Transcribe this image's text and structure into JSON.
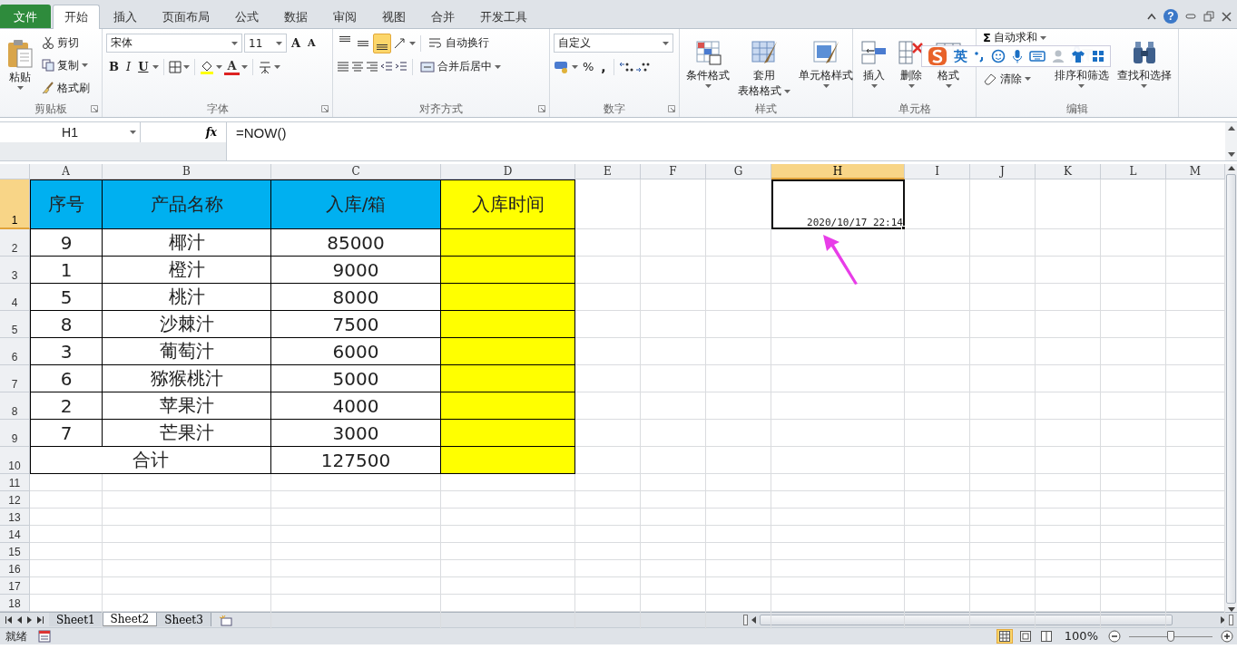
{
  "ribbon_tabs": [
    {
      "label": "文件",
      "kind": "file",
      "selected": false
    },
    {
      "label": "开始",
      "kind": "tab",
      "selected": true
    },
    {
      "label": "插入",
      "kind": "tab",
      "selected": false
    },
    {
      "label": "页面布局",
      "kind": "tab",
      "selected": false
    },
    {
      "label": "公式",
      "kind": "tab",
      "selected": false
    },
    {
      "label": "数据",
      "kind": "tab",
      "selected": false
    },
    {
      "label": "审阅",
      "kind": "tab",
      "selected": false
    },
    {
      "label": "视图",
      "kind": "tab",
      "selected": false
    },
    {
      "label": "合并",
      "kind": "tab",
      "selected": false
    },
    {
      "label": "开发工具",
      "kind": "tab",
      "selected": false
    }
  ],
  "window_controls": {
    "help": "?"
  },
  "clipboard": {
    "label": "剪贴板",
    "paste": "粘贴",
    "cut": "剪切",
    "copy": "复制",
    "format_painter": "格式刷"
  },
  "font": {
    "label": "字体",
    "font_name": "宋体",
    "font_size": "11",
    "grow": "A",
    "shrink": "A",
    "bold": "B",
    "italic": "I",
    "underline": "U",
    "font_color": "A"
  },
  "alignment": {
    "label": "对齐方式",
    "vertical_align": [
      {
        "selected": false
      },
      {
        "selected": false
      },
      {
        "selected": true
      }
    ],
    "wrap_text": "自动换行",
    "merge_center": "合并后居中"
  },
  "number": {
    "label": "数字",
    "format": "自定义",
    "percent": "%",
    "comma": ","
  },
  "styles": {
    "label": "样式",
    "buttons": [
      {
        "lines": [
          "条件格式"
        ],
        "kind": "conditional"
      },
      {
        "lines": [
          "套用",
          "表格格式"
        ],
        "kind": "table"
      },
      {
        "lines": [
          "单元格样式"
        ],
        "kind": "cellstyle"
      }
    ]
  },
  "cells": {
    "label": "单元格",
    "buttons": [
      {
        "lines": [
          "插入"
        ],
        "kind": "insert"
      },
      {
        "lines": [
          "删除"
        ],
        "kind": "delete"
      },
      {
        "lines": [
          "格式"
        ],
        "kind": "format"
      }
    ]
  },
  "editing": {
    "label": "编辑",
    "sum_symbol": "Σ",
    "autosum": "自动求和",
    "clear": "清除",
    "buttons": [
      {
        "lines": [
          "排序和筛选"
        ],
        "kind": "sort"
      },
      {
        "lines": [
          "查找和选择"
        ],
        "kind": "find"
      }
    ]
  },
  "ime_toolbar": {
    "lang": "英"
  },
  "formula_bar": {
    "name_box": "H1",
    "function_button": "fx",
    "formula": "=NOW()"
  },
  "sheet": {
    "columns": [
      {
        "label": "A",
        "selected": false
      },
      {
        "label": "B",
        "selected": false
      },
      {
        "label": "C",
        "selected": false
      },
      {
        "label": "D",
        "selected": false
      },
      {
        "label": "E",
        "selected": false
      },
      {
        "label": "F",
        "selected": false
      },
      {
        "label": "G",
        "selected": false
      },
      {
        "label": "H",
        "selected": true
      },
      {
        "label": "I",
        "selected": false
      },
      {
        "label": "J",
        "selected": false
      },
      {
        "label": "K",
        "selected": false
      },
      {
        "label": "L",
        "selected": false
      },
      {
        "label": "M",
        "selected": false
      }
    ],
    "rows": [
      {
        "label": "1",
        "selected": true
      },
      {
        "label": "2",
        "selected": false
      },
      {
        "label": "3",
        "selected": false
      },
      {
        "label": "4",
        "selected": false
      },
      {
        "label": "5",
        "selected": false
      },
      {
        "label": "6",
        "selected": false
      },
      {
        "label": "7",
        "selected": false
      },
      {
        "label": "8",
        "selected": false
      },
      {
        "label": "9",
        "selected": false
      },
      {
        "label": "10",
        "selected": false
      },
      {
        "label": "11",
        "selected": false
      },
      {
        "label": "12",
        "selected": false
      },
      {
        "label": "13",
        "selected": false
      },
      {
        "label": "14",
        "selected": false
      },
      {
        "label": "15",
        "selected": false
      },
      {
        "label": "16",
        "selected": false
      },
      {
        "label": "17",
        "selected": false
      },
      {
        "label": "18",
        "selected": false
      }
    ],
    "table": {
      "columns": [
        {
          "label": "序号",
          "color": "#00b0f0",
          "highlighted": false
        },
        {
          "label": "产品名称",
          "color": "#00b0f0",
          "highlighted": false
        },
        {
          "label": "入库/箱",
          "color": "#00b0f0",
          "highlighted": false
        },
        {
          "label": "入库时间",
          "color": "#ffff00",
          "highlighted": true
        }
      ],
      "rows": [
        [
          "9",
          "椰汁",
          "85000"
        ],
        [
          "1",
          "橙汁",
          "9000"
        ],
        [
          "5",
          "桃汁",
          "8000"
        ],
        [
          "8",
          "沙棘汁",
          "7500"
        ],
        [
          "3",
          "葡萄汁",
          "6000"
        ],
        [
          "6",
          "猕猴桃汁",
          "5000"
        ],
        [
          "2",
          "苹果汁",
          "4000"
        ],
        [
          "7",
          "芒果汁",
          "3000"
        ]
      ],
      "total": {
        "label": "合计",
        "value": "127500"
      }
    },
    "active_cell": {
      "value": "2020/10/17 22:14"
    }
  },
  "sheet_tabs": [
    {
      "label": "Sheet1",
      "selected": false
    },
    {
      "label": "Sheet2",
      "selected": true
    },
    {
      "label": "Sheet3",
      "selected": false
    }
  ],
  "status_bar": {
    "status": "就绪",
    "views": [
      {
        "selected": true
      },
      {
        "selected": false
      },
      {
        "selected": false
      }
    ],
    "zoom": "100%",
    "zoom_slider": {
      "level": 0.5
    }
  }
}
